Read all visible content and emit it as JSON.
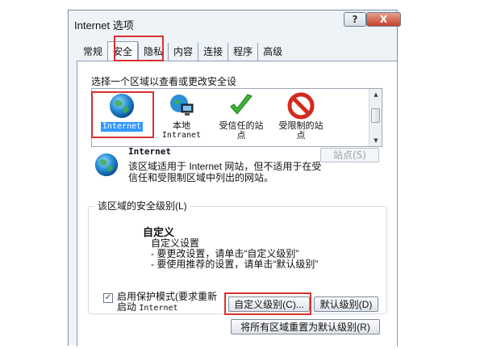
{
  "window": {
    "title": "Internet 选项",
    "help_label": "?",
    "close_label": "X"
  },
  "tabs": [
    {
      "label": "常规"
    },
    {
      "label": "安全"
    },
    {
      "label": "隐私"
    },
    {
      "label": "内容"
    },
    {
      "label": "连接"
    },
    {
      "label": "程序"
    },
    {
      "label": "高级"
    }
  ],
  "zones": {
    "prompt": "选择一个区域以查看或更改安全设",
    "items": [
      {
        "label": "Internet",
        "icon": "globe-icon"
      },
      {
        "label": "本地",
        "sublabel": "Intranet",
        "icon": "intranet-icon"
      },
      {
        "label": "受信任的站",
        "sublabel": "点",
        "icon": "checkmark-icon"
      },
      {
        "label": "受限制的站",
        "sublabel": "点",
        "icon": "restricted-icon"
      }
    ]
  },
  "selected_zone": {
    "title": "Internet",
    "description": "该区域适用于 Internet 网站，但不适用于在受信任和受限制区域中列出的网站。",
    "sites_button": "站点(S)"
  },
  "security_level": {
    "legend": "该区域的安全级别(L)",
    "title": "自定义",
    "lines": [
      "自定义设置",
      "- 要更改设置，请单击“自定义级别”",
      "- 要使用推荐的设置，请单击“默认级别”"
    ],
    "protected_mode_line1": "启用保护模式(要求重新",
    "protected_mode_line2_prefix": "启动",
    "protected_mode_line2_mono": "Internet",
    "protected_mode_checked": true,
    "custom_button": "自定义级别(C)...",
    "default_button": "默认级别(D)",
    "reset_button": "将所有区域重置为默认级别(R)"
  },
  "colors": {
    "highlight": "#d8322c",
    "selection": "#3399ff"
  }
}
